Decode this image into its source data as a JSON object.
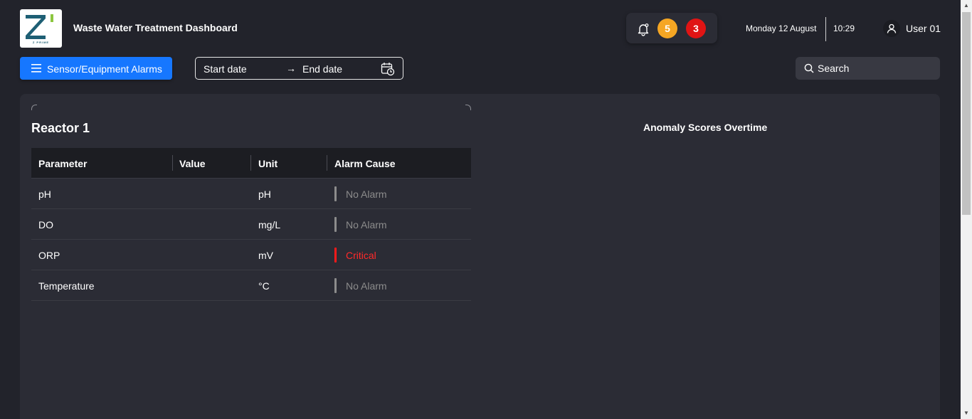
{
  "header": {
    "logo_text": "Z PRIME",
    "title": "Waste Water Treatment Dashboard",
    "notifications": {
      "warning_count": "5",
      "critical_count": "3"
    },
    "date": "Monday 12 August",
    "time": "10:29",
    "user": "User 01"
  },
  "toolbar": {
    "alarms_button": "Sensor/Equipment Alarms",
    "date_range": {
      "start_placeholder": "Start date",
      "arrow": "→",
      "end_placeholder": "End date"
    },
    "search_placeholder": "Search"
  },
  "reactor": {
    "title": "Reactor 1",
    "columns": [
      "Parameter",
      "Value",
      "Unit",
      "Alarm Cause"
    ],
    "rows": [
      {
        "parameter": "pH",
        "value": "",
        "unit": "pH",
        "alarm": "No Alarm",
        "status": "normal"
      },
      {
        "parameter": "DO",
        "value": "",
        "unit": "mg/L",
        "alarm": "No Alarm",
        "status": "normal"
      },
      {
        "parameter": "ORP",
        "value": "",
        "unit": "mV",
        "alarm": "Critical",
        "status": "critical"
      },
      {
        "parameter": "Temperature",
        "value": "",
        "unit": "°C",
        "alarm": "No Alarm",
        "status": "normal"
      }
    ]
  },
  "chart": {
    "title": "Anomaly Scores Overtime"
  },
  "colors": {
    "background": "#22232b",
    "panel": "#2b2c35",
    "accent": "#1677ff",
    "warning": "#f5a623",
    "critical": "#e01414",
    "no_alarm_text": "#8c8c8c",
    "no_alarm_bar": "#8c8c8c",
    "critical_text": "#ff2a2a"
  }
}
